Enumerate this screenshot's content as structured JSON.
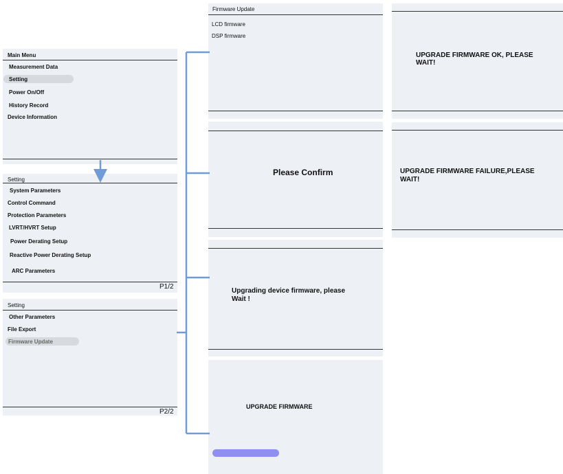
{
  "colors": {
    "panel_bg": "#edf0f5",
    "connector": "#6f9bd6",
    "highlight_pill": "#d6d9de",
    "progress_bar": "#8f8ff2"
  },
  "main_menu": {
    "title": "Main Menu",
    "items": [
      "Measurement Data",
      "Setting",
      "Power On/Off",
      "History Record",
      "Device Information"
    ],
    "selected": "Setting"
  },
  "setting_p1": {
    "title": "Setting",
    "items": [
      "System Parameters",
      "Control Command",
      "Protection Parameters",
      "LVRT/HVRT Setup",
      "Power Derating Setup",
      "Reactive Power Derating Setup",
      "ARC Parameters"
    ],
    "page": "P1/2"
  },
  "setting_p2": {
    "title": "Setting",
    "items": [
      "Other Parameters",
      "File Export",
      "Firmware Update"
    ],
    "selected": "Firmware Update",
    "page": "P2/2"
  },
  "firmware_update": {
    "title": "Firmware Update",
    "items": [
      "LCD firmware",
      "DSP firmware"
    ]
  },
  "confirm": {
    "message": "Please Confirm"
  },
  "upgrading": {
    "line1": "Upgrading device firmware, please",
    "line2": "Wait !"
  },
  "upgrade": {
    "message": "UPGRADE FIRMWARE"
  },
  "ok": {
    "line1": "UPGRADE FIRMWARE OK, PLEASE",
    "line2": "WAIT!"
  },
  "failure": {
    "line1": "UPGRADE FIRMWARE FAILURE,PLEASE",
    "line2": "WAIT!"
  }
}
